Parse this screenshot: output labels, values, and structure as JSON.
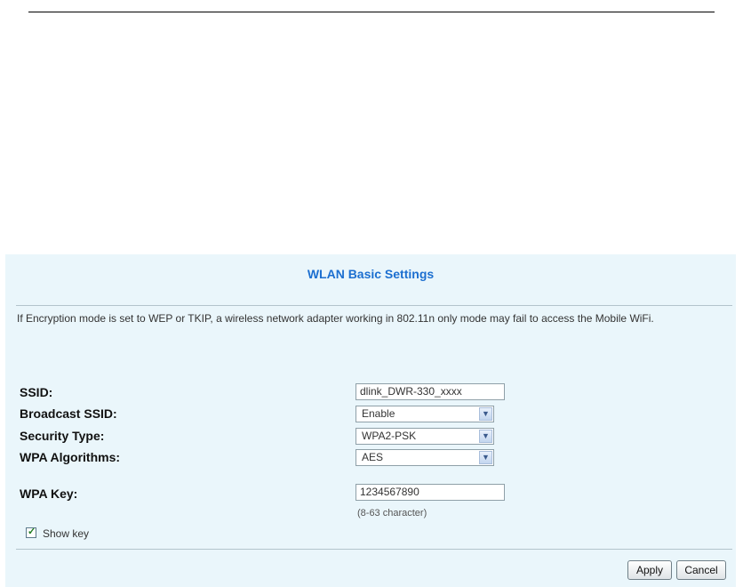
{
  "panel": {
    "title": "WLAN Basic Settings",
    "notice": "If Encryption mode is set to WEP or TKIP, a wireless network adapter working in 802.11n only mode may fail to access the Mobile WiFi."
  },
  "fields": {
    "ssid": {
      "label": "SSID:",
      "value": "dlink_DWR-330_xxxx"
    },
    "broadcast_ssid": {
      "label": "Broadcast SSID:",
      "value": "Enable"
    },
    "security_type": {
      "label": "Security Type:",
      "value": "WPA2-PSK"
    },
    "wpa_algorithms": {
      "label": "WPA Algorithms:",
      "value": "AES"
    },
    "wpa_key": {
      "label": "WPA Key:",
      "value": "1234567890",
      "hint": "(8-63 character)"
    }
  },
  "show_key": {
    "label": "Show key",
    "checked": true
  },
  "buttons": {
    "apply": "Apply",
    "cancel": "Cancel"
  },
  "icons": {
    "dropdown": "chevron-down-icon",
    "check": "checkmark-icon"
  },
  "colors": {
    "panel_bg": "#eaf6fb",
    "title": "#1c6fd0"
  }
}
